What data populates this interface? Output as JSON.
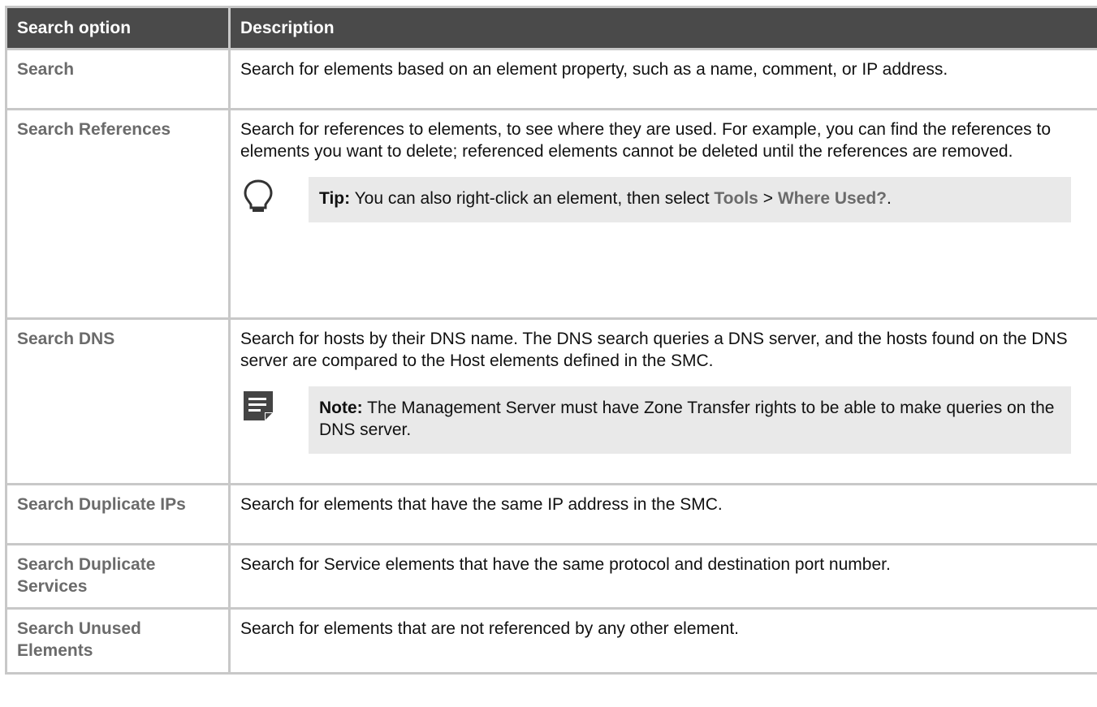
{
  "table": {
    "headers": [
      "Search option",
      "Description"
    ],
    "rows": [
      {
        "option": "Search",
        "description": "Search for elements based on an element property, such as a name, comment, or IP address."
      },
      {
        "option": "Search References",
        "description": "Search for references to elements, to see where they are used. For example, you can find the references to elements you want to delete; referenced elements cannot be deleted until the references are removed.",
        "callout": {
          "icon": "lightbulb-icon",
          "label": "Tip:",
          "text_before": "You can also right-click an element, then select",
          "menu_1": "Tools",
          "separator": ">",
          "menu_2": "Where Used?",
          "end": "."
        }
      },
      {
        "option": "Search DNS",
        "description": "Search for hosts by their DNS name. The DNS search queries a DNS server, and the hosts found on the DNS server are compared to the Host elements defined in the SMC.",
        "callout": {
          "icon": "note-icon",
          "label": "Note:",
          "text": "The Management Server must have Zone Transfer rights to be able to make queries on the DNS server."
        }
      },
      {
        "option": "Search Duplicate IPs",
        "description": "Search for elements that have the same IP address in the SMC."
      },
      {
        "option": "Search Duplicate Services",
        "description": "Search for Service elements that have the same protocol and destination port number."
      },
      {
        "option": "Search Unused Elements",
        "description": "Search for elements that are not referenced by any other element."
      }
    ]
  },
  "colors": {
    "header_bg": "#4a4a4a",
    "border": "#c8c8c8",
    "option_text": "#6b6b6b",
    "callout_bg": "#e9e9e9"
  }
}
